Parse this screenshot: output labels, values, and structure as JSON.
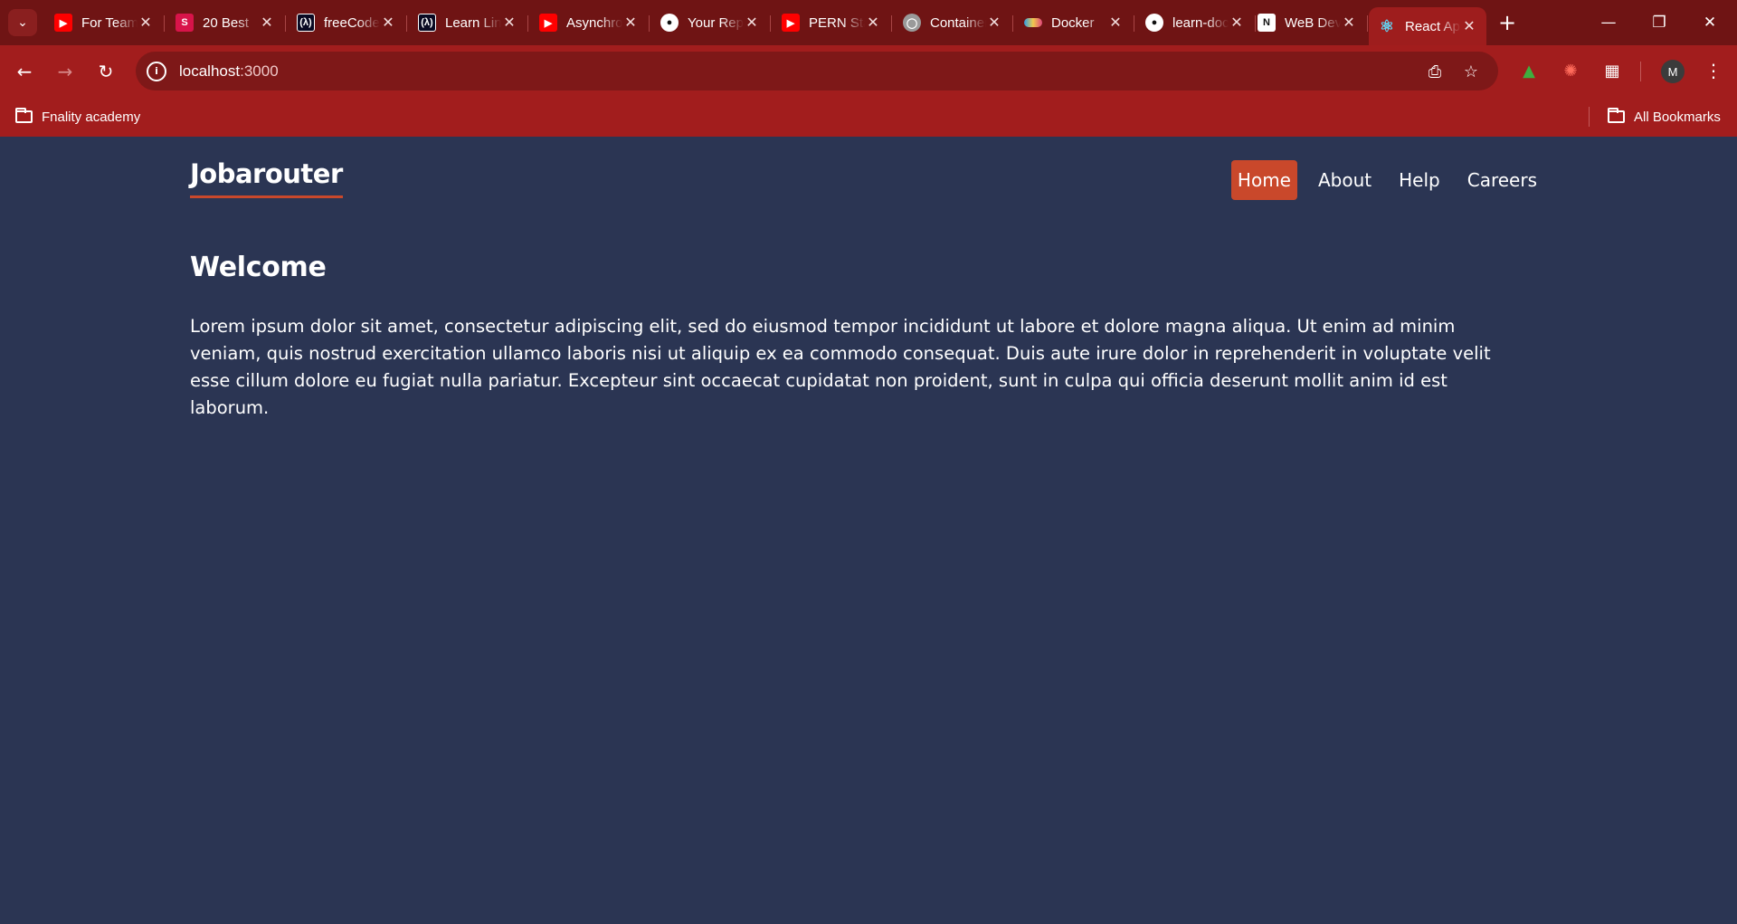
{
  "browser": {
    "tabs": [
      {
        "label": "For Teams",
        "favicon": "youtube-icon",
        "color": "#ff0000"
      },
      {
        "label": "20 Best",
        "favicon": "s-letter-icon",
        "color": "#d8144a"
      },
      {
        "label": "freeCodeCamp",
        "favicon": "freecodecamp-icon",
        "color": "#0a0a23"
      },
      {
        "label": "Learn Linux",
        "favicon": "freecodecamp-icon",
        "color": "#0a0a23"
      },
      {
        "label": "Asynchronous",
        "favicon": "youtube-icon",
        "color": "#ff0000"
      },
      {
        "label": "Your Repositories",
        "favicon": "github-icon",
        "color": "#ffffff"
      },
      {
        "label": "PERN Stack",
        "favicon": "youtube-icon",
        "color": "#ff0000"
      },
      {
        "label": "Containers",
        "favicon": "globe-icon",
        "color": "#cfcfcf"
      },
      {
        "label": "Docker",
        "favicon": "docker-icon",
        "color": "#2f9fe6"
      },
      {
        "label": "learn-docker",
        "favicon": "github-icon",
        "color": "#ffffff"
      },
      {
        "label": "WeB Dev",
        "favicon": "notion-icon",
        "color": "#ffffff"
      },
      {
        "label": "React App",
        "favicon": "react-icon",
        "color": "#61dafb",
        "active": true
      }
    ],
    "address": {
      "host": "localhost",
      "port": ":3000"
    },
    "bookmarks": {
      "left": "Fnality academy",
      "right": "All Bookmarks"
    },
    "avatar_letter": "M",
    "theme": {
      "tabstrip": "#6f1414",
      "toolbar": "#a21d1d",
      "omnibox": "#7e1818"
    }
  },
  "app": {
    "brand": "Jobarouter",
    "nav": [
      {
        "label": "Home",
        "active": true
      },
      {
        "label": "About",
        "active": false
      },
      {
        "label": "Help",
        "active": false
      },
      {
        "label": "Careers",
        "active": false
      }
    ],
    "heading": "Welcome",
    "paragraph": "Lorem ipsum dolor sit amet, consectetur adipiscing elit, sed do eiusmod tempor incididunt ut labore et dolore magna aliqua. Ut enim ad minim veniam, quis nostrud exercitation ullamco laboris nisi ut aliquip ex ea commodo consequat. Duis aute irure dolor in reprehenderit in voluptate velit esse cillum dolore eu fugiat nulla pariatur. Excepteur sint occaecat cupidatat non proident, sunt in culpa qui officia deserunt mollit anim id est laborum.",
    "colors": {
      "background": "#2b3553",
      "accent": "#c9482b",
      "text": "#ffffff"
    }
  }
}
